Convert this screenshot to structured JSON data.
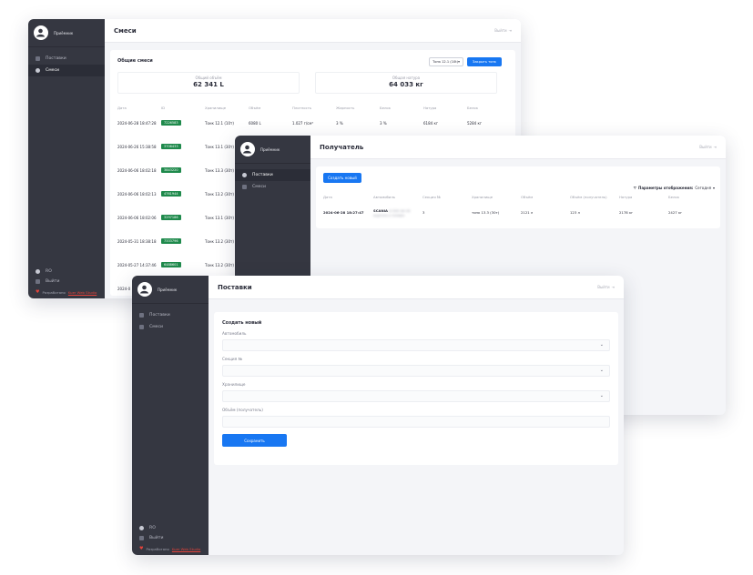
{
  "sidebar": {
    "profile_name": "Приёмник",
    "nav": [
      "Поставки",
      "Смеси"
    ],
    "bottom": [
      "RO",
      "Выйти"
    ],
    "credit_prefix": "Разработано",
    "credit_link": "Kuer Web Studio"
  },
  "receiver_sidebar": {
    "nav": [
      "Поставки",
      "Смеси"
    ]
  },
  "header": {
    "logout_label": "Выйти"
  },
  "mixes": {
    "title": "Смеси",
    "card_title": "Общие смеси",
    "tank_select": "Тонк 12.1 (10t)",
    "close_tank_button": "Закрыть тонк",
    "stat_volume_label": "Общий объём",
    "stat_volume_value": "62 341 L",
    "stat_weight_label": "Общая натура",
    "stat_weight_value": "64 033 кг",
    "columns": [
      "Дата",
      "ID",
      "Хранилище",
      "Объём",
      "Плотность",
      "Жирность",
      "Белок",
      "Натура",
      "Белок"
    ],
    "rows": [
      {
        "date": "2024-06-28 18:47:28",
        "id": "7226583",
        "tank": "Тонк 12.1 (10т)",
        "volume": "6080 L",
        "density": "1.027 г/см³",
        "fat": "3 %",
        "protein": "3 %",
        "weight": "6184 кг",
        "protein2": "5284 кг"
      },
      {
        "date": "2024-06-26 15:38:58",
        "id": "3706433",
        "tank": "Тонк 13.1 (30т)"
      },
      {
        "date": "2024-06-06 18:02:18",
        "id": "3843220",
        "tank": "Тонк 13.3 (30т)"
      },
      {
        "date": "2024-06-06 18:02:13",
        "id": "4761944",
        "tank": "Тонк 13.2 (30т)"
      },
      {
        "date": "2024-06-06 18:02:06",
        "id": "3297186",
        "tank": "Тонк 13.1 (30т)"
      },
      {
        "date": "2024-05-31 18:38:18",
        "id": "7333796",
        "tank": "Тонк 13.2 (30т)"
      },
      {
        "date": "2024-05-27 14:37:46",
        "id": "6488601",
        "tank": "Тонк 13.2 (30т)"
      },
      {
        "date": "2024-0",
        "id": "",
        "tank": ""
      }
    ]
  },
  "receiver": {
    "title": "Получатель",
    "create_button": "Создать новый",
    "display_params": "Параметры отображения:",
    "display_sort": "Сегодня",
    "columns": [
      "Дата",
      "Автомобиль",
      "Секция №",
      "Хранилище",
      "Объём",
      "Объём (получатель)",
      "Натура",
      "Белок"
    ],
    "row": {
      "date": "2024-06-28 18:27:47",
      "vehicle": "SCANIA",
      "vehicle_hidden": "А 000 АА 00",
      "vehicle_hidden2": "водитель и телефон",
      "section": "3",
      "tank": "тонк 13.3 (30т)",
      "volume": "2121 л",
      "volume_recv": "123 л",
      "weight": "2178 кг",
      "protein": "2427 кг"
    }
  },
  "supplies": {
    "title": "Поставки",
    "form_title": "Создать новый",
    "fields": [
      "Автомобиль",
      "Секция №",
      "Хранилище",
      "Объём (получатель)"
    ],
    "save_button": "Сохранить"
  }
}
